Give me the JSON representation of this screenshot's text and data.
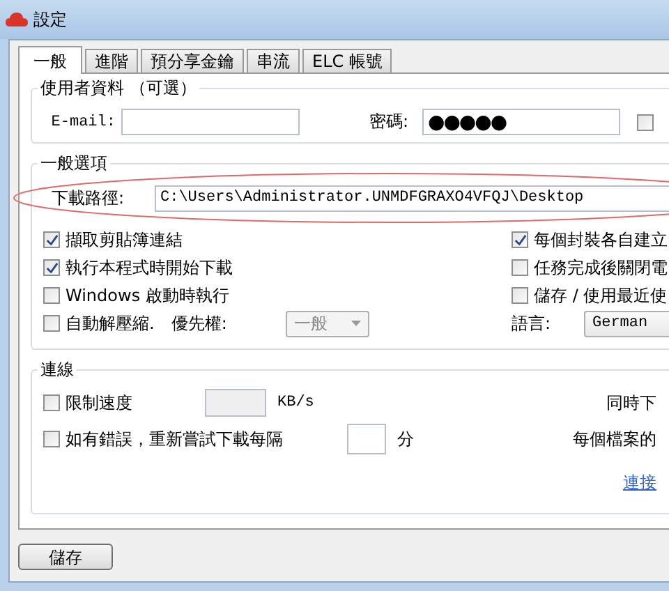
{
  "window": {
    "title": "設定"
  },
  "tabs": [
    {
      "label": "一般",
      "selected": true
    },
    {
      "label": "進階",
      "selected": false
    },
    {
      "label": "預分享金鑰",
      "selected": false
    },
    {
      "label": "串流",
      "selected": false
    },
    {
      "label": "ELC 帳號",
      "selected": false
    }
  ],
  "user_info": {
    "title": "使用者資料 （可選）",
    "email": {
      "label": "E-mail:"
    },
    "password": {
      "label": "密碼:",
      "value": "●●●●●"
    },
    "show_password": {
      "checked": false
    }
  },
  "general": {
    "title": "一般選項",
    "download_path": {
      "label": "下載路徑:",
      "value": "C:\\Users\\Administrator.UNMDFGRAXO4VFQJ\\Desktop"
    },
    "left_options": [
      {
        "label": "擷取剪貼簿連結",
        "checked": true
      },
      {
        "label": "執行本程式時開始下載",
        "checked": true
      },
      {
        "label": "Windows 啟動時執行",
        "checked": false
      },
      {
        "label": "自動解壓縮.",
        "checked": false
      }
    ],
    "priority": {
      "label": "優先權:",
      "value": "一般",
      "disabled": true
    },
    "right_options": [
      {
        "label": "每個封裝各自建立",
        "checked": true
      },
      {
        "label": "任務完成後關閉電",
        "checked": false
      },
      {
        "label": "儲存 / 使用最近使",
        "checked": false
      }
    ],
    "language": {
      "label": "語言:",
      "value": "German"
    }
  },
  "connection": {
    "title": "連線",
    "limit_speed": {
      "label": "限制速度",
      "checked": false,
      "disabled": true,
      "unit": "KB/s"
    },
    "retry": {
      "label": "如有錯誤，重新嘗試下載每隔",
      "checked": false,
      "unit": "分"
    },
    "right_labels": [
      "同時下",
      "每個檔案的"
    ],
    "link": "連接"
  },
  "buttons": [
    {
      "label": "儲存"
    }
  ]
}
